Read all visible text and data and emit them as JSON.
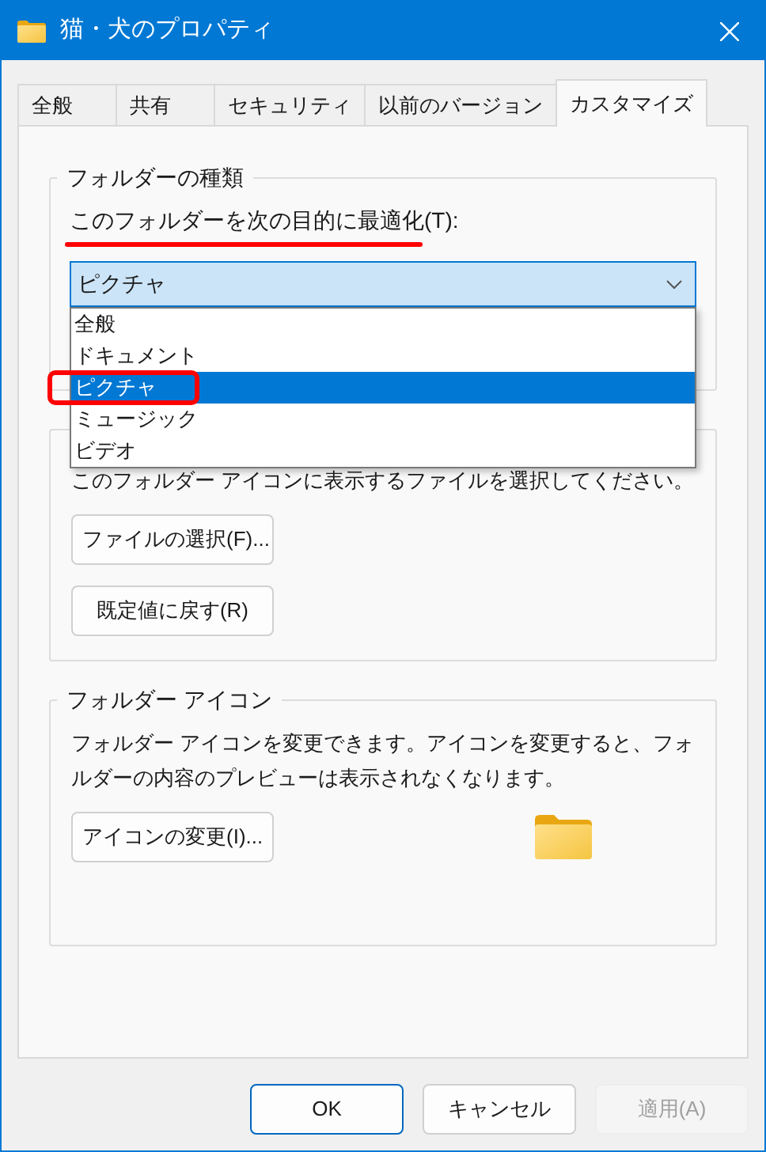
{
  "window": {
    "title": "猫・犬のプロパティ"
  },
  "tabs": [
    {
      "label": "全般",
      "selected": false
    },
    {
      "label": "共有",
      "selected": false
    },
    {
      "label": "セキュリティ",
      "selected": false
    },
    {
      "label": "以前のバージョン",
      "selected": false
    },
    {
      "label": "カスタマイズ",
      "selected": true
    }
  ],
  "folder_type": {
    "title": "フォルダーの種類",
    "label": "このフォルダーを次の目的に最適化(T):",
    "combo": {
      "value": "ピクチャ",
      "expanded": true
    },
    "options": [
      {
        "label": "全般",
        "selected": false
      },
      {
        "label": "ドキュメント",
        "selected": false
      },
      {
        "label": "ピクチャ",
        "selected": true
      },
      {
        "label": "ミュージック",
        "selected": false
      },
      {
        "label": "ビデオ",
        "selected": false
      }
    ]
  },
  "folder_picture": {
    "description": "このフォルダー アイコンに表示するファイルを選択してください。",
    "buttons": [
      "ファイルの選択(F)...",
      "既定値に戻す(R)"
    ]
  },
  "folder_icon": {
    "title": "フォルダー アイコン",
    "description": "フォルダー アイコンを変更できます。アイコンを変更すると、フォルダーの内容のプレビューは表示されなくなります。",
    "button": "アイコンの変更(I)..."
  },
  "annotations": {
    "underline_label": true,
    "highlight_selected": true
  },
  "buttons": [
    {
      "label": "OK",
      "default": true,
      "disabled": false
    },
    {
      "label": "キャンセル",
      "default": false,
      "disabled": false
    },
    {
      "label": "適用(A)",
      "default": false,
      "disabled": true
    }
  ]
}
